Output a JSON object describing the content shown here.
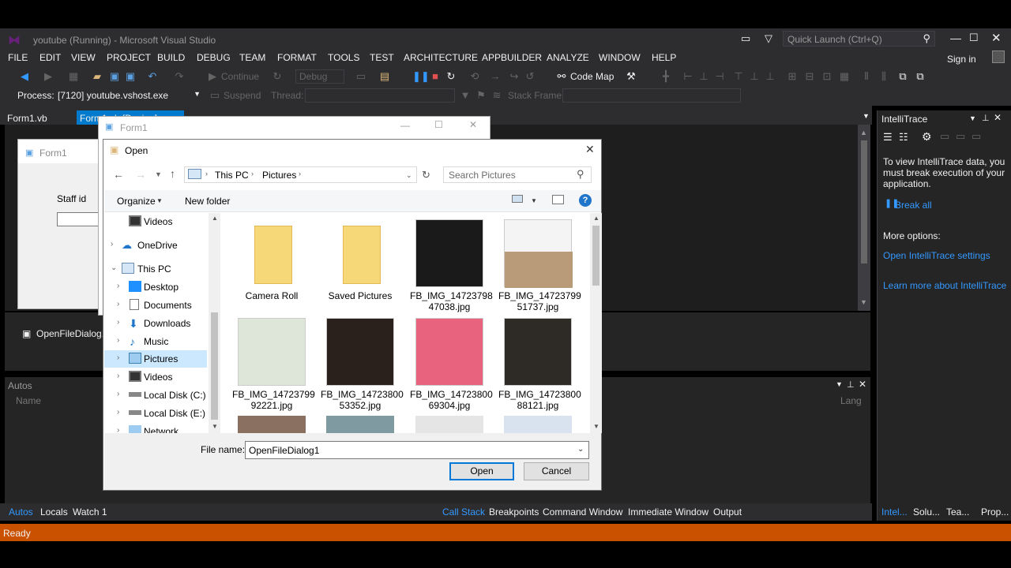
{
  "window": {
    "title": "youtube (Running) - Microsoft Visual Studio",
    "quick_launch_placeholder": "Quick Launch (Ctrl+Q)",
    "sign_in": "Sign in"
  },
  "menu": [
    "FILE",
    "EDIT",
    "VIEW",
    "PROJECT",
    "BUILD",
    "DEBUG",
    "TEAM",
    "FORMAT",
    "TOOLS",
    "TEST",
    "ARCHITECTURE",
    "APPBUILDER",
    "ANALYZE",
    "WINDOW",
    "HELP"
  ],
  "toolbar": {
    "continue": "Continue",
    "config": "Debug",
    "code_map": "Code Map"
  },
  "toolbar2": {
    "process_label": "Process:",
    "process_value": "[7120] youtube.vshost.exe",
    "suspend": "Suspend",
    "thread_label": "Thread:",
    "stack_frame_label": "Stack Frame:"
  },
  "doc_tabs": {
    "tab1": "Form1.vb",
    "tab2": "Form1.vb [Design]"
  },
  "designer": {
    "form_title": "Form1",
    "staff_label": "Staff id"
  },
  "tray": {
    "component": "OpenFileDialog1"
  },
  "autos": {
    "title": "Autos",
    "col_name": "Name",
    "col_lang": "Lang"
  },
  "bottom_tabs": {
    "left": [
      "Autos",
      "Locals",
      "Watch 1"
    ],
    "right": [
      "Call Stack",
      "Breakpoints",
      "Command Window",
      "Immediate Window",
      "Output"
    ],
    "side": [
      "Intel...",
      "Solu...",
      "Tea...",
      "Prop..."
    ]
  },
  "intellitrace": {
    "title": "IntelliTrace",
    "message": "To view IntelliTrace data, you must break execution of your application.",
    "break_all": "Break all",
    "more_options": "More options:",
    "open_settings": "Open IntelliTrace settings",
    "learn_more": "Learn more about IntelliTrace"
  },
  "status": {
    "text": "Ready"
  },
  "form1_window": {
    "title": "Form1"
  },
  "dialog": {
    "title": "Open",
    "breadcrumb": [
      "This PC",
      "Pictures"
    ],
    "search_placeholder": "Search Pictures",
    "organize": "Organize",
    "new_folder": "New folder",
    "nav": [
      "Videos",
      "OneDrive",
      "This PC",
      "Desktop",
      "Documents",
      "Downloads",
      "Music",
      "Pictures",
      "Videos",
      "Local Disk (C:)",
      "Local Disk (E:)",
      "Network"
    ],
    "files": [
      {
        "name": "Camera Roll",
        "kind": "folder"
      },
      {
        "name": "Saved Pictures",
        "kind": "folder"
      },
      {
        "name": "FB_IMG_14723798\n47038.jpg",
        "kind": "image"
      },
      {
        "name": "FB_IMG_14723799\n51737.jpg",
        "kind": "image"
      },
      {
        "name": "FB_IMG_14723799\n92221.jpg",
        "kind": "image"
      },
      {
        "name": "FB_IMG_14723800\n53352.jpg",
        "kind": "image"
      },
      {
        "name": "FB_IMG_14723800\n69304.jpg",
        "kind": "image"
      },
      {
        "name": "FB_IMG_14723800\n88121.jpg",
        "kind": "image"
      }
    ],
    "file_name_label": "File name:",
    "file_name_value": "OpenFileDialog1",
    "open_button": "Open",
    "cancel_button": "Cancel"
  },
  "colors": {
    "vs_bg": "#2d2d30",
    "status": "#ca5100",
    "accent": "#007acc",
    "link": "#3399ff"
  }
}
